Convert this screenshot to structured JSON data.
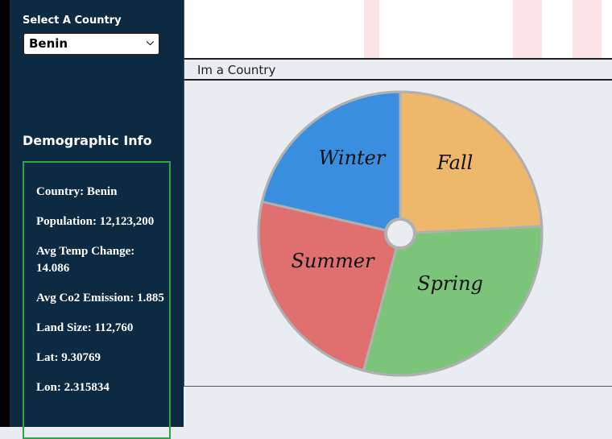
{
  "sidebar": {
    "select_label": "Select A Country",
    "selected_country": "Benin",
    "demo_heading": "Demographic Info",
    "info": [
      "Country: Benin",
      "Population: 12,123,200",
      "Avg Temp Change: 14.086",
      "Avg Co2 Emission: 1.885",
      "Land Size: 112,760",
      "Lat: 9.30769",
      "Lon: 2.315834"
    ]
  },
  "main": {
    "title": "Im a Country"
  },
  "wheel": {
    "segments": [
      {
        "label": "Fall",
        "color": "#eeb86c"
      },
      {
        "label": "Spring",
        "color": "#7cc47a"
      },
      {
        "label": "Summer",
        "color": "#e07070"
      },
      {
        "label": "Winter",
        "color": "#3a8ee0"
      }
    ],
    "border_color": "#b0b0b0"
  },
  "colors": {
    "sidebar_bg": "#0c2a42",
    "info_border": "#2fa34a",
    "stripe": "#fbe3e6"
  }
}
